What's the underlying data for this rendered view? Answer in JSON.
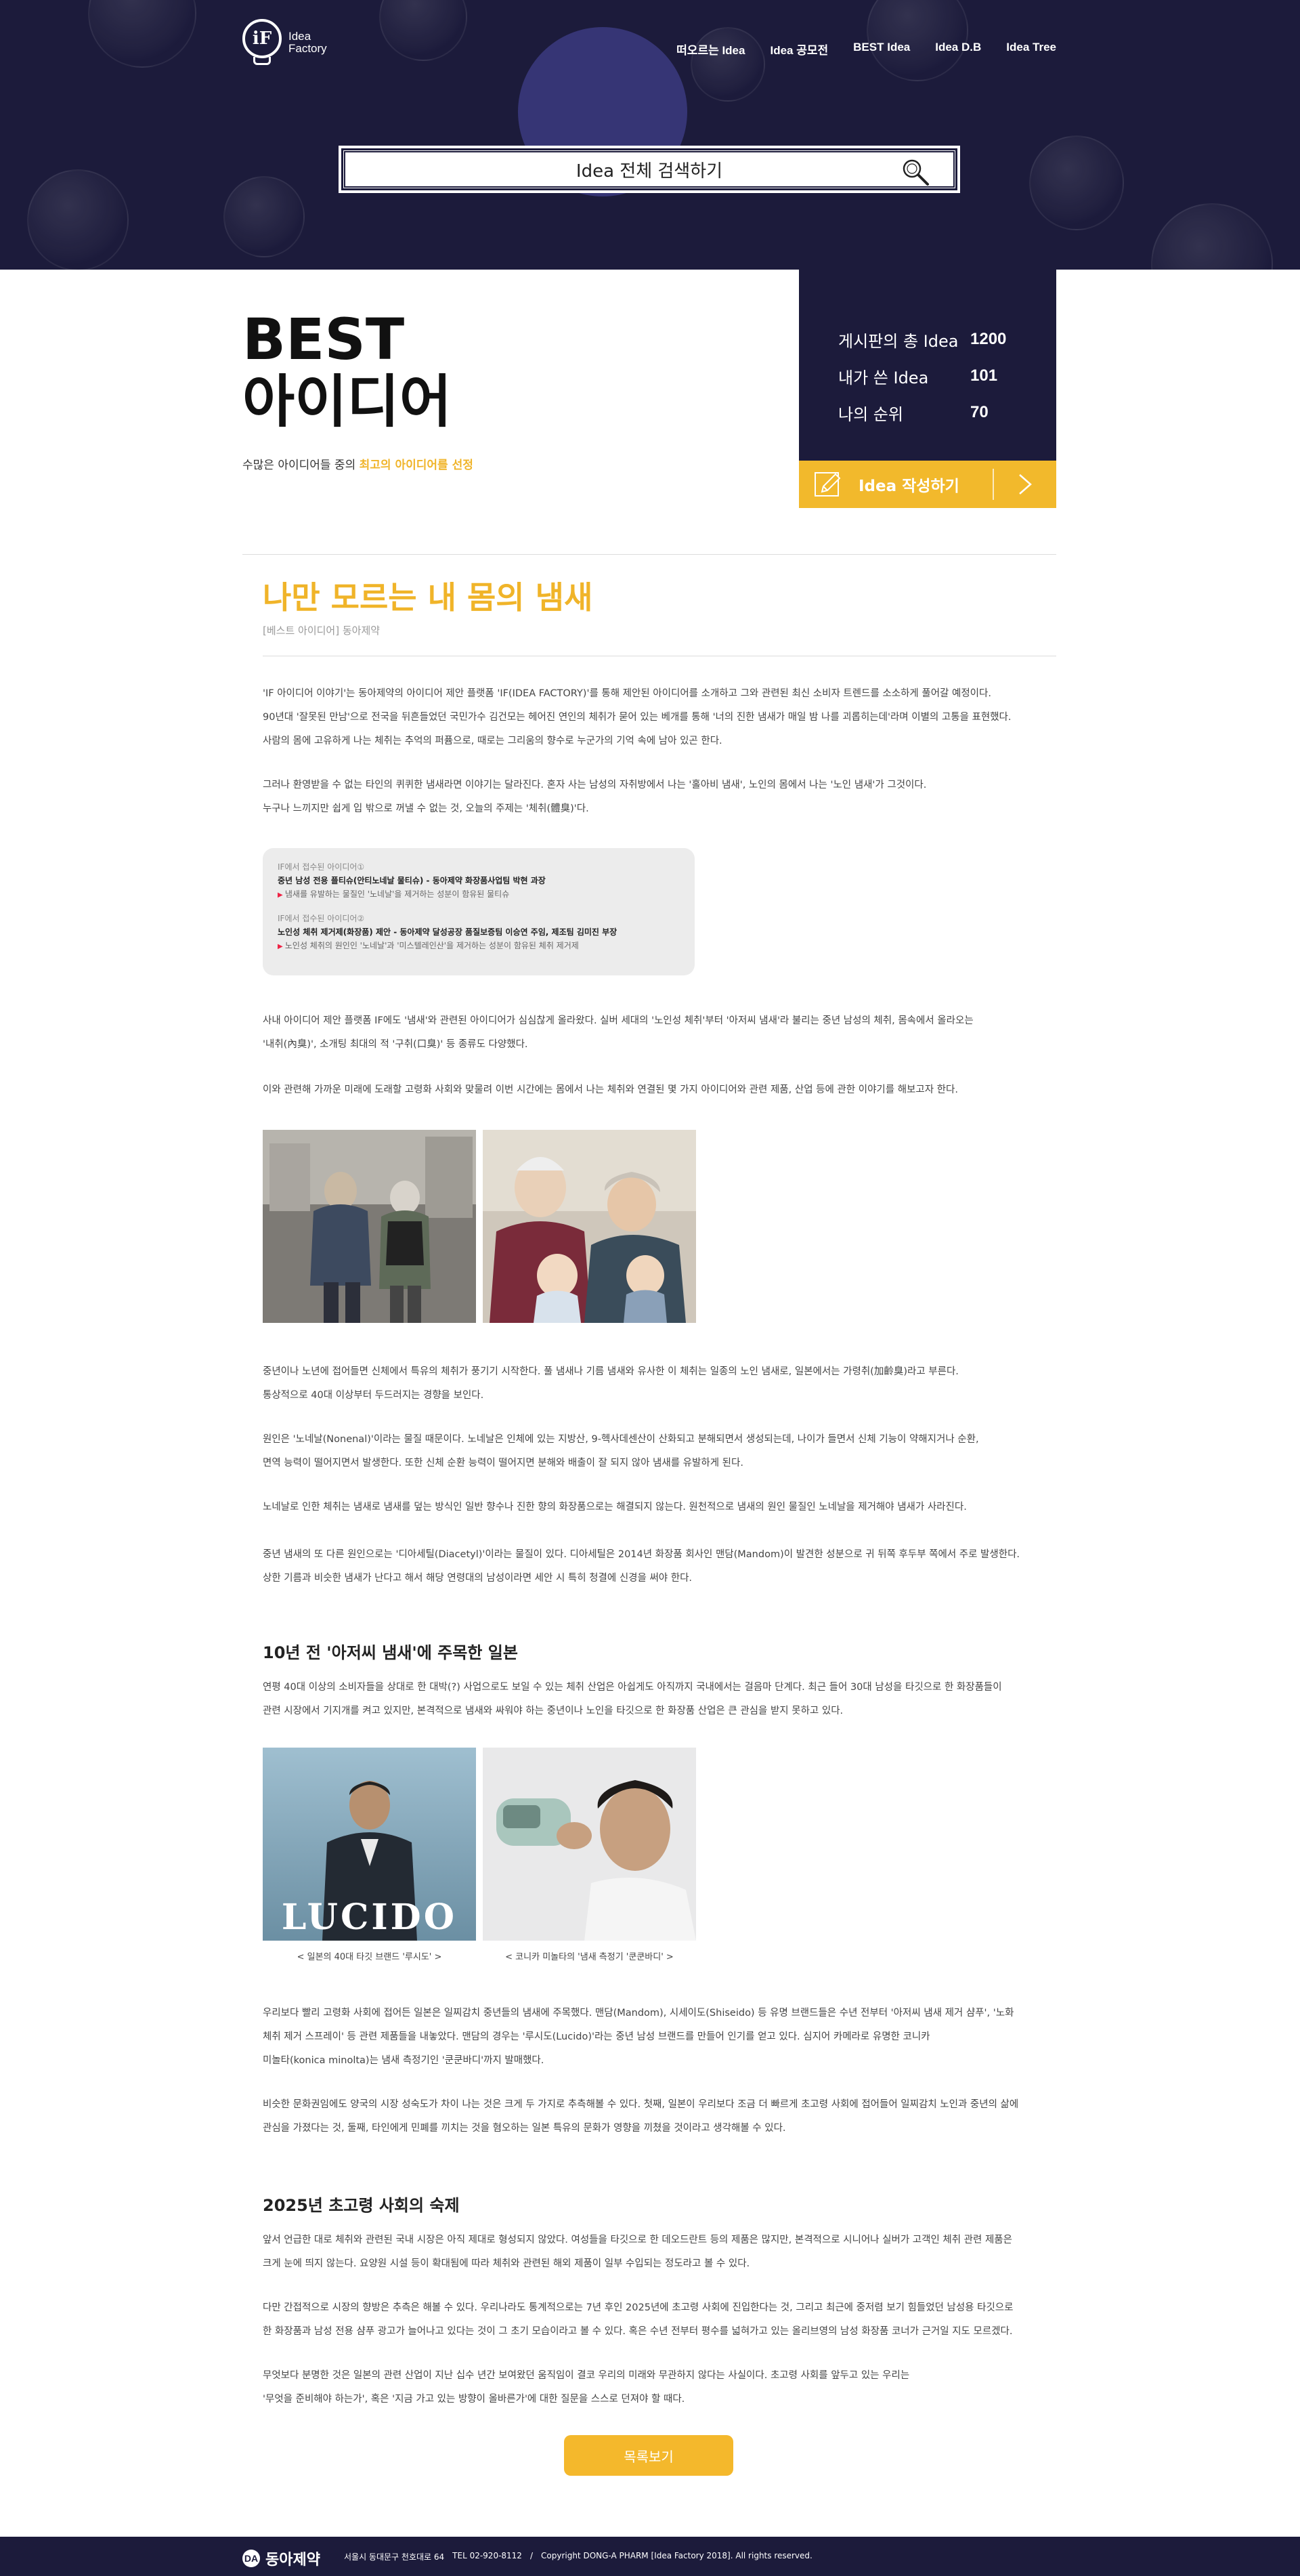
{
  "header": {
    "logo_text_line1": "Idea",
    "logo_text_line2": "Factory",
    "logo_mark": "iF",
    "nav": [
      "떠오르는 Idea",
      "Idea 공모전",
      "BEST Idea",
      "Idea D.B",
      "Idea Tree"
    ],
    "search_placeholder": "Idea 전체 검색하기"
  },
  "best": {
    "title_line1": "BEST",
    "title_line2": "아이디어",
    "subtitle_prefix": "수많은 아이디어들 중의 ",
    "subtitle_highlight": "최고의 아이디어를 선정"
  },
  "stats": [
    {
      "label": "게시판의 총 Idea",
      "value": "1200"
    },
    {
      "label": "내가 쓴 Idea",
      "value": "101"
    },
    {
      "label": "나의 순위",
      "value": "70"
    }
  ],
  "write_button_label": "Idea 작성하기",
  "article": {
    "title": "나만 모르는 내 몸의 냄새",
    "category": "[베스트 아이디어] 동아제약",
    "intro": [
      "'IF 아이디어 이야기'는 동아제약의 아이디어 제안 플랫폼 'IF(IDEA FACTORY)'를 통해 제안된 아이디어를 소개하고 그와 관련된 최신 소비자 트렌드를 소소하게 풀어갈 예정이다.",
      "90년대 '잘못된 만남'으로 전국을 뒤흔들었던 국민가수 김건모는 헤어진 연인의 체취가 묻어 있는 베개를 통해 '너의 진한 냄새가 매일 밤 나를 괴롭히는데'라며 이별의 고통을 표현했다.",
      "사람의 몸에 고유하게 나는 체취는 추억의 퍼퓸으로, 때로는 그리움의 향수로 누군가의 기억 속에 남아 있곤 한다."
    ],
    "para2": [
      "그러나 환영받을 수 없는 타인의 퀴퀴한 냄새라면 이야기는 달라진다. 혼자 사는 남성의 자취방에서 나는 '홀아비 냄새', 노인의 몸에서 나는 '노인 냄새'가 그것이다.",
      "누구나 느끼지만 쉽게 입 밖으로 꺼낼 수 없는 것, 오늘의 주제는 '체취(體臭)'다."
    ],
    "refbox": [
      {
        "source": "IF에서 접수된 아이디어①",
        "title": "중년 남성 전용 플티슈(안티노네날 물티슈) - 동아제약 화장품사업팀 박현 과장",
        "desc": "냄새를 유발하는 물질인 '노네날'을 제거하는 성분이 함유된 물티슈"
      },
      {
        "source": "IF에서 접수된 아이디어②",
        "title": "노인성 체취 제거제(화장품) 제안 - 동아제약 달성공장 품질보증팀 이승연 주임, 제조팀 김미진 부장",
        "desc": "노인성 체취의 원인인 '노네날'과 '미스텔레인산'을 제거하는 성분이 함유된 체취 제거제"
      }
    ],
    "para3": [
      "사내 아이디어 제안 플랫폼 IF에도 '냄새'와 관련된 아이디어가 심심찮게 올라왔다. 실버 세대의 '노인성 체취'부터 '아저씨 냄새'라 불리는 중년 남성의 체취, 몸속에서 올라오는",
      "'내취(內臭)', 소개팅 최대의 적 '구취(口臭)' 등 종류도 다양했다."
    ],
    "para4": "이와 관련해 가까운 미래에 도래할 고령화 사회와 맞물려 이번 시간에는 몸에서 나는 체취와 연결된 몇 가지 아이디어와 관련 제품, 산업 등에 관한 이야기를 해보고자 한다.",
    "para5": [
      "중년이나 노년에 접어들면 신체에서 특유의 체취가 풍기기 시작한다. 풀 냄새나 기름 냄새와 유사한 이 체취는 일종의 노인 냄새로, 일본에서는 가령취(加齡臭)라고 부른다.",
      "통상적으로 40대 이상부터 두드러지는 경향을 보인다."
    ],
    "para6": [
      "원인은 '노네날(Nonenal)'이라는 물질 때문이다. 노네날은 인체에 있는 지방산, 9-헥사데센산이 산화되고 분해되면서 생성되는데, 나이가 들면서 신체 기능이 약해지거나 순환,",
      "면역 능력이 떨어지면서 발생한다. 또한 신체 순환 능력이 떨어지면 분해와 배출이 잘 되지 않아 냄새를 유발하게 된다."
    ],
    "para7": "노네날로 인한 체취는 냄새로 냄새를 덮는 방식인 일반 향수나 진한 향의 화장품으로는 해결되지 않는다. 원천적으로 냄새의 원인 물질인 노네날을 제거해야 냄새가 사라진다.",
    "para8": [
      "중년 냄새의 또 다른 원인으로는 '디아세틸(Diacetyl)'이라는 물질이 있다. 디아세틸은 2014년 화장품 회사인 맨담(Mandom)이 발견한 성분으로 귀 뒤쪽 후두부 쪽에서 주로 발생한다.",
      "상한 기름과 비슷한 냄새가 난다고 해서 해당 연령대의 남성이라면 세안 시 특히 청결에 신경을 써야 한다."
    ],
    "h2_japan": "10년 전 '아저씨 냄새'에 주목한 일본",
    "para9": [
      "연평 40대 이상의 소비자들을 상대로 한 대박(?) 사업으로도 보일 수 있는 체취 산업은 아쉽게도 아직까지 국내에서는 걸음마 단계다. 최근 들어 30대 남성을 타깃으로 한 화장품들이",
      "관련 시장에서 기지개를 켜고 있지만, 본격적으로 냄새와 싸워야 하는 중년이나 노인을 타깃으로 한 화장품 산업은 큰 관심을 받지 못하고 있다."
    ],
    "brand_text": "LUCIDO",
    "caption1": "< 일본의 40대 타깃 브랜드 '루시도' >",
    "caption2": "< 코니카 미놀타의 '냄새 측정기 '쿤쿤바디' >",
    "para10": [
      "우리보다 빨리 고령화 사회에 접어든 일본은 일찌감치 중년들의 냄새에 주목했다. 맨담(Mandom), 시세이도(Shiseido) 등 유명 브랜드들은 수년 전부터 '아저씨 냄새 제거 샴푸', '노화",
      "체취 제거 스프레이' 등 관련 제품들을 내놓았다. 맨담의 경우는 '루시도(Lucido)'라는 중년 남성 브랜드를 만들어 인기를 얻고 있다. 심지어 카메라로 유명한 코니카",
      "미놀타(konica minolta)는 냄새 측정기인 '쿤쿤바디'까지 발매했다."
    ],
    "para11": [
      "비슷한 문화권임에도 양국의 시장 성숙도가 차이 나는 것은 크게 두 가지로 추측해볼 수 있다. 첫째, 일본이 우리보다 조금 더 빠르게 초고령 사회에 접어들어 일찌감치 노인과 중년의 삶에",
      "관심을 가졌다는 것, 둘째, 타인에게 민폐를 끼치는 것을 혐오하는 일본 특유의 문화가 영향을 끼쳤을 것이라고 생각해볼 수 있다."
    ],
    "h2_2025": "2025년 초고령 사회의 숙제",
    "para12": [
      "앞서 언급한 대로 체취와 관련된 국내 시장은 아직 제대로 형성되지 않았다. 여성들을 타깃으로 한 데오드란트 등의 제품은 많지만, 본격적으로 시니어나 실버가 고객인 체취 관련 제품은",
      "크게 눈에 띄지 않는다. 요양원 시설 등이 확대됨에 따라 체취와 관련된 해외 제품이 일부 수입되는 정도라고 볼 수 있다."
    ],
    "para13": [
      "다만 간접적으로 시장의 향방은 추측은 해볼 수 있다. 우리나라도 통계적으로는 7년 후인 2025년에 초고령 사회에 진입한다는 것, 그리고 최근에 중저렴 보기 힘들었던 남성용 타깃으로",
      "한 화장품과 남성 전용 샴푸 광고가 늘어나고 있다는 것이 그 초기 모습이라고 볼 수 있다. 혹은 수년 전부터 평수를 넓혀가고 있는 올리브영의 남성 화장품 코너가 근거일 지도 모르겠다."
    ],
    "para14": [
      "무엇보다 분명한 것은 일본의 관련 산업이 지난 십수 년간 보여왔던 움직임이 결코 우리의 미래와 무관하지 않다는 사실이다. 초고령 사회를 앞두고 있는 우리는",
      "'무엇을 준비해야 하는가', 혹은 '지금 가고 있는 방향이 올바른가'에 대한 질문을 스스로 던져야 할 때다."
    ],
    "list_button_label": "목록보기"
  },
  "footer": {
    "brand": "동아제약",
    "brand_mark": "DA",
    "address": "서울시 동대문구 천호대로 64",
    "tel": "TEL 02-920-8112",
    "divider": "/",
    "copyright": "Copyright DONG-A PHARM [Idea Factory 2018]. All rights reserved."
  },
  "colors": {
    "navy": "#1c1b3b",
    "accent": "#f0b429",
    "button": "#f4b82c"
  },
  "icons": {
    "search": "search-icon",
    "write": "pencil-icon",
    "arrow": "chevron-right-icon"
  }
}
